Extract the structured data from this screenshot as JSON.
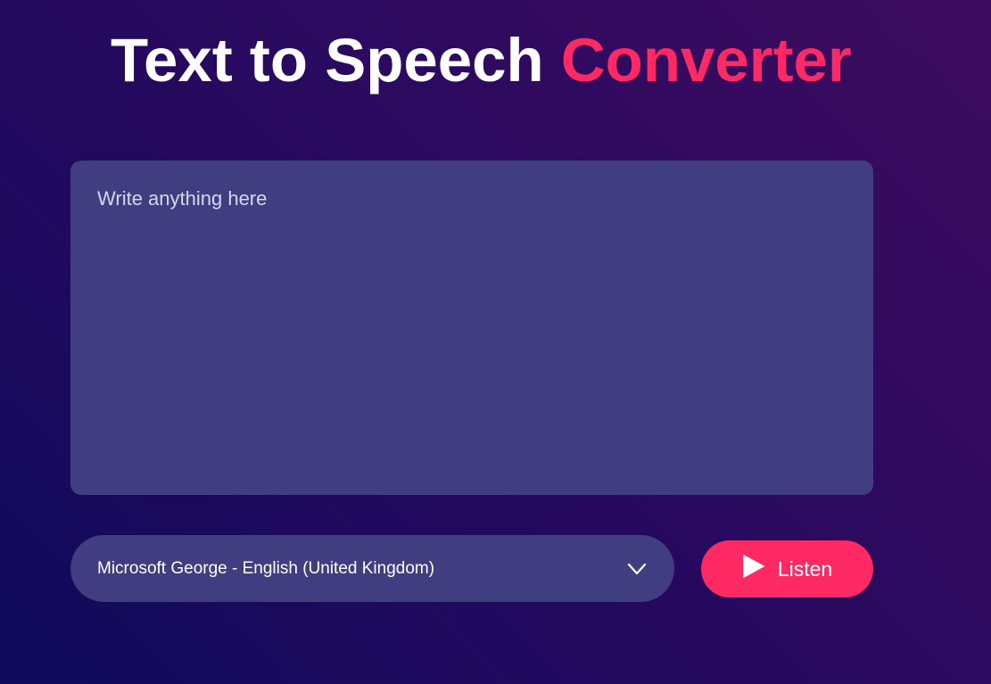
{
  "header": {
    "title_part1": "Text to Speech ",
    "title_part2": "Converter"
  },
  "editor": {
    "placeholder": "Write anything here",
    "value": ""
  },
  "voice": {
    "selected": "Microsoft George - English (United Kingdom)"
  },
  "actions": {
    "listen_label": "Listen"
  },
  "icons": {
    "dropdown": "chevron-down-icon",
    "listen": "play-icon"
  },
  "colors": {
    "accent": "#ff2964",
    "panel": "#403d80",
    "text": "#ffffff"
  }
}
